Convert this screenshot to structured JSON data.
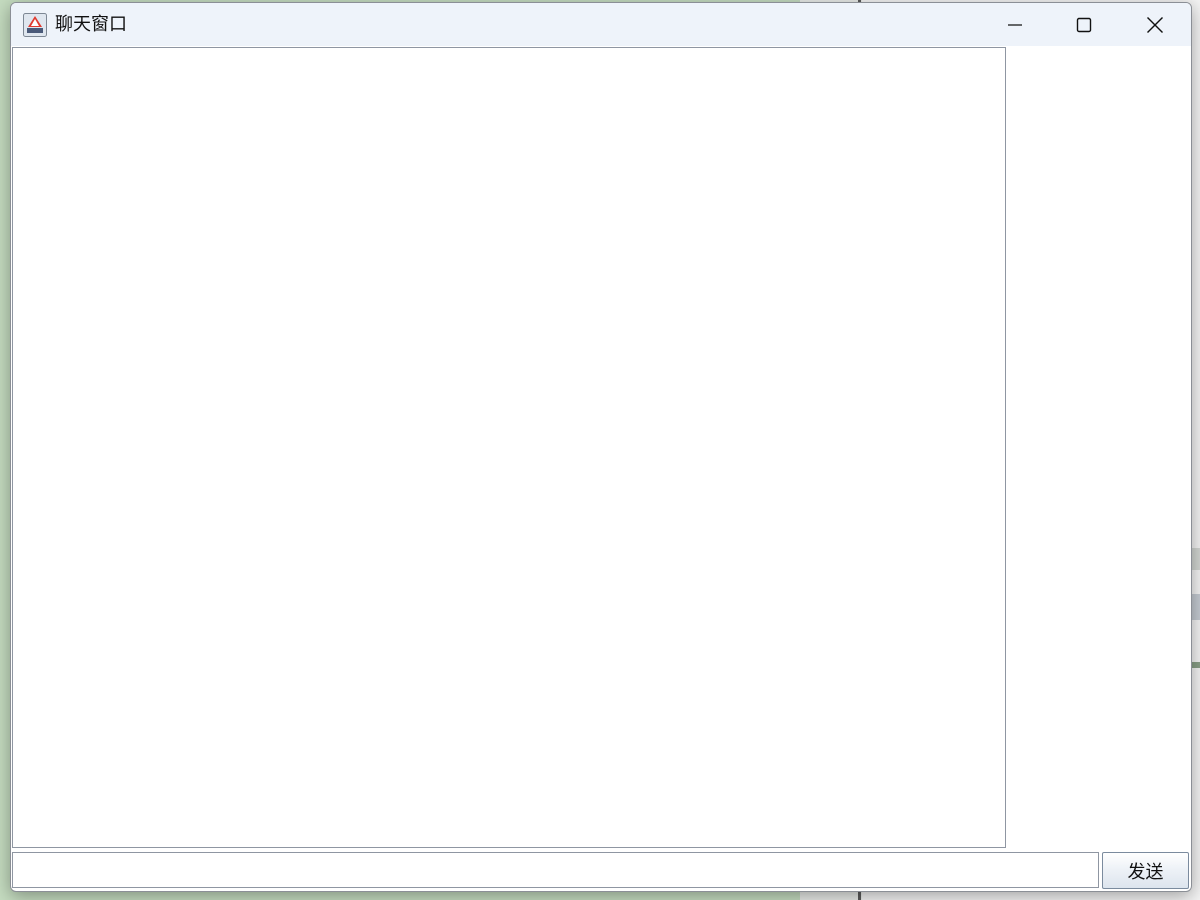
{
  "window": {
    "title": "聊天窗口"
  },
  "chat": {
    "input_value": "",
    "input_placeholder": "",
    "send_label": "发送"
  },
  "icons": {
    "app": "java-app-icon",
    "minimize": "minimize-icon",
    "maximize": "maximize-icon",
    "close": "close-icon"
  },
  "colors": {
    "titlebar": "#eef3fa",
    "window_bg": "#ffffff",
    "border": "#8f96a2"
  }
}
